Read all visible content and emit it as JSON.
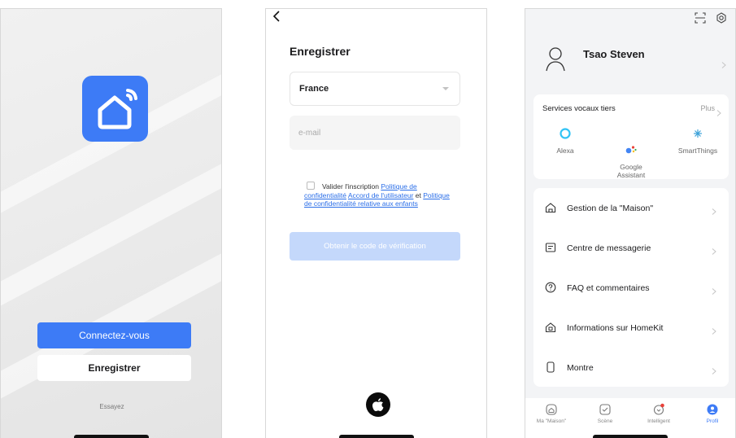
{
  "colors": {
    "accent": "#3d7bf6",
    "link": "#2a6ee8",
    "disabled_button": "#c4d8fb",
    "badge": "#e9413a"
  },
  "welcome": {
    "login_label": "Connectez-vous",
    "register_label": "Enregistrer",
    "try_label": "Essayez",
    "logo_icon": "smart-home-wifi-icon"
  },
  "register": {
    "title": "Enregistrer",
    "country": "France",
    "email_placeholder": "e-mail",
    "consent_prefix": "Valider l'inscription",
    "privacy_link": "Politique de confidentialité",
    "user_agreement_link": "Accord de l'utilisateur",
    "and_text": "et",
    "children_privacy_link": "Politique de confidentialité relative aux enfants",
    "code_button": "Obtenir le code de vérification",
    "apple_icon": "apple-icon"
  },
  "profile": {
    "user_name": "Tsao Steven",
    "voice_services": {
      "title": "Services vocaux tiers",
      "more": "Plus",
      "items": [
        {
          "label": "Alexa",
          "icon": "alexa-icon",
          "color": "#31c3f5"
        },
        {
          "label": "Google\nAssistant",
          "icon": "google-assistant-icon"
        },
        {
          "label": "SmartThings",
          "icon": "smartthings-icon",
          "color": "#3aa1d8"
        }
      ]
    },
    "menu": [
      {
        "label": "Gestion de la \"Maison\"",
        "icon": "house-icon"
      },
      {
        "label": "Centre de messagerie",
        "icon": "message-icon"
      },
      {
        "label": "FAQ et commentaires",
        "icon": "help-icon"
      },
      {
        "label": "Informations sur HomeKit",
        "icon": "homekit-icon"
      },
      {
        "label": "Montre",
        "icon": "watch-icon"
      }
    ],
    "tabs": [
      {
        "label": "Ma \"Maison\"",
        "icon": "home-tab-icon"
      },
      {
        "label": "Scène",
        "icon": "scene-tab-icon"
      },
      {
        "label": "Intelligent",
        "icon": "smart-tab-icon"
      },
      {
        "label": "Profil",
        "icon": "profile-tab-icon",
        "active": true
      }
    ]
  }
}
